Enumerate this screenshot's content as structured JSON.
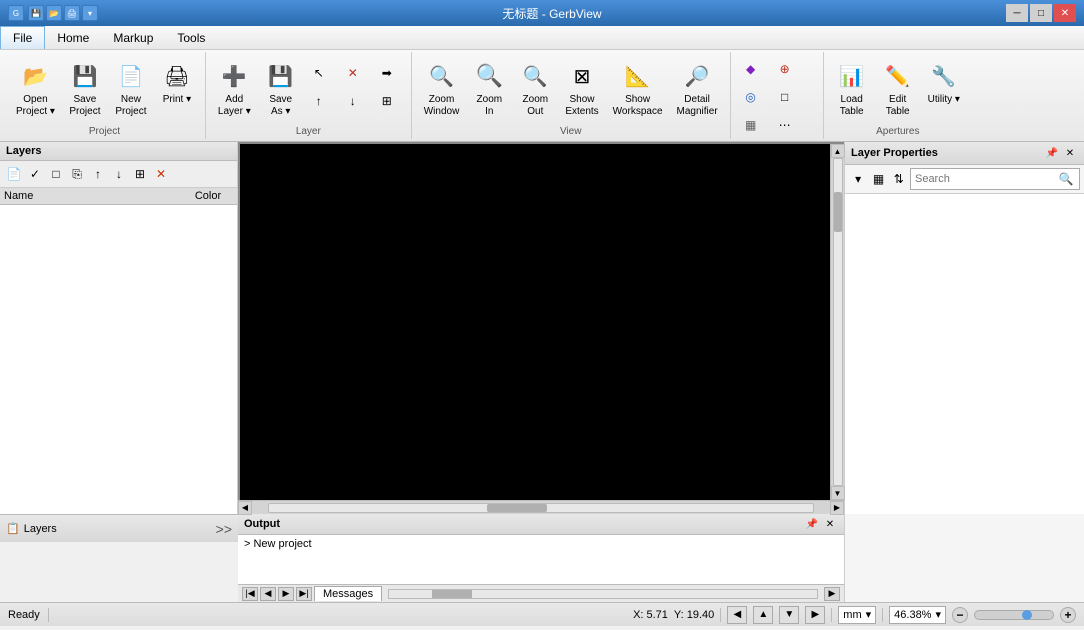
{
  "window": {
    "title": "无标题 - GerbView"
  },
  "menu": {
    "items": [
      "File",
      "Home",
      "Markup",
      "Tools"
    ],
    "active": "Home"
  },
  "ribbon": {
    "groups": [
      {
        "label": "Project",
        "buttons": [
          {
            "id": "open-project",
            "label": "Open\nProject",
            "icon": "📂",
            "has_dropdown": true
          },
          {
            "id": "save-project",
            "label": "Save\nProject",
            "icon": "💾",
            "has_dropdown": false
          },
          {
            "id": "new-project",
            "label": "New\nProject",
            "icon": "📄",
            "has_dropdown": false
          }
        ],
        "small_buttons": [
          {
            "id": "print",
            "label": "Print",
            "icon": "🖨️"
          }
        ]
      },
      {
        "label": "Layer",
        "buttons": [
          {
            "id": "add-layer",
            "label": "Add\nLayer",
            "icon": "➕",
            "has_dropdown": true
          },
          {
            "id": "save-as",
            "label": "Save\nAs",
            "icon": "💾",
            "has_dropdown": true
          }
        ],
        "tool_buttons": [
          {
            "id": "select-tool",
            "icon": "↖"
          },
          {
            "id": "delete-tool",
            "icon": "✕",
            "color": "red"
          },
          {
            "id": "move-up-tool",
            "icon": "▲"
          },
          {
            "id": "move-down-tool",
            "icon": "▼"
          },
          {
            "id": "merge-tool",
            "icon": "⊞"
          }
        ]
      },
      {
        "label": "View",
        "buttons": [
          {
            "id": "zoom-window",
            "label": "Zoom\nWindow",
            "icon": "🔍"
          },
          {
            "id": "zoom-in",
            "label": "Zoom\nIn",
            "icon": "🔍"
          },
          {
            "id": "zoom-out",
            "label": "Zoom\nOut",
            "icon": "🔍"
          },
          {
            "id": "show-extents",
            "label": "Show\nExtents",
            "icon": "⊞"
          },
          {
            "id": "show-workspace",
            "label": "Show\nWorkspace",
            "icon": "📐"
          },
          {
            "id": "detail-magnifier",
            "label": "Detail\nMagnifier",
            "icon": "🔎"
          }
        ]
      },
      {
        "label": "Apertures",
        "buttons": [
          {
            "id": "load-table",
            "label": "Load\nTable",
            "icon": "📊"
          },
          {
            "id": "edit-table",
            "label": "Edit\nTable",
            "icon": "✏️"
          },
          {
            "id": "utility",
            "label": "Utility",
            "icon": "🔧",
            "has_dropdown": true
          }
        ]
      }
    ]
  },
  "layers_panel": {
    "title": "Layers",
    "columns": {
      "name": "Name",
      "color": "Color"
    },
    "toolbar_buttons": [
      {
        "id": "layer-new",
        "icon": "📄",
        "tooltip": "New"
      },
      {
        "id": "layer-check",
        "icon": "✓",
        "tooltip": "Check"
      },
      {
        "id": "layer-rect",
        "icon": "□",
        "tooltip": "Rectangle"
      },
      {
        "id": "layer-copy",
        "icon": "⎘",
        "tooltip": "Copy"
      },
      {
        "id": "layer-up",
        "icon": "↑",
        "tooltip": "Move Up"
      },
      {
        "id": "layer-down",
        "icon": "↓",
        "tooltip": "Move Down"
      },
      {
        "id": "layer-merge",
        "icon": "⊞",
        "tooltip": "Merge"
      },
      {
        "id": "layer-delete",
        "icon": "✕",
        "tooltip": "Delete",
        "danger": true
      }
    ],
    "bottom_icon": "📋",
    "bottom_label": "Layers"
  },
  "canvas": {
    "background": "black"
  },
  "layer_properties": {
    "title": "Layer Properties",
    "search_placeholder": "Search",
    "toolbar_buttons": [
      {
        "id": "props-table",
        "icon": "▦"
      },
      {
        "id": "props-sort",
        "icon": "⇅"
      }
    ]
  },
  "output_panel": {
    "title": "Output",
    "content": "> New project",
    "tabs": [
      {
        "id": "messages",
        "label": "Messages"
      }
    ]
  },
  "status_bar": {
    "ready": "Ready",
    "x_coord": "X: 5.71",
    "y_coord": "Y: 19.40",
    "unit": "mm",
    "zoom": "46.38%",
    "nav_buttons": [
      "◀◀",
      "◀",
      "▶",
      "▶▶"
    ]
  }
}
